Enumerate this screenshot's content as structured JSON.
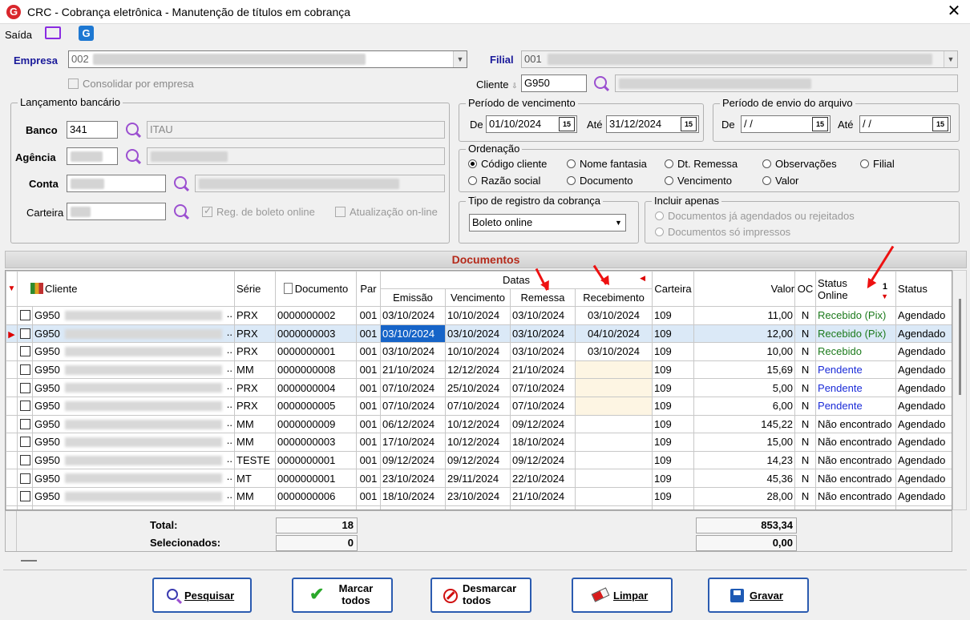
{
  "window": {
    "title": "CRC - Cobrança eletrônica - Manutenção de títulos em cobrança"
  },
  "menu": {
    "exit_label": "Saída"
  },
  "empresa": {
    "label": "Empresa",
    "code": "002",
    "consolidar_label": "Consolidar por empresa"
  },
  "filial": {
    "label": "Filial",
    "code": "001"
  },
  "cliente": {
    "label": "Cliente",
    "code": "G950"
  },
  "lancamento": {
    "title": "Lançamento bancário",
    "banco_label": "Banco",
    "banco_code": "341",
    "banco_name": "ITAU",
    "agencia_label": "Agência",
    "conta_label": "Conta",
    "carteira_label": "Carteira",
    "reg_boleto_label": "Reg. de boleto online",
    "atualizacao_label": "Atualização on-line"
  },
  "vencimento": {
    "title": "Período de vencimento",
    "de_label": "De",
    "de": "01/10/2024",
    "ate_label": "Até",
    "ate": "31/12/2024"
  },
  "envio": {
    "title": "Período de envio do arquivo",
    "de_label": "De",
    "de": " / /",
    "ate_label": "Até",
    "ate": " / /"
  },
  "ordenacao": {
    "title": "Ordenação",
    "options": [
      "Código cliente",
      "Nome fantasia",
      "Dt. Remessa",
      "Observações",
      "Filial",
      "Razão social",
      "Documento",
      "Vencimento",
      "Valor"
    ],
    "selected": "Código cliente"
  },
  "tipo_registro": {
    "title": "Tipo de registro da cobrança",
    "value": "Boleto online"
  },
  "incluir": {
    "title": "Incluir apenas",
    "opt1": "Documentos já agendados ou rejeitados",
    "opt2": "Documentos só impressos"
  },
  "section_title": "Documentos",
  "grid": {
    "headers": {
      "cliente": "Cliente",
      "serie": "Série",
      "documento": "Documento",
      "par": "Par",
      "datas": "Datas",
      "emissao": "Emissão",
      "vencimento": "Vencimento",
      "remessa": "Remessa",
      "recebimento": "Recebimento",
      "carteira": "Carteira",
      "valor": "Valor",
      "oc": "OC",
      "status_online": "Status Online",
      "sort_num": "1",
      "status": "Status"
    },
    "rows": [
      {
        "cliente": "G950",
        "serie": "PRX",
        "documento": "0000000002",
        "par": "001",
        "emissao": "03/10/2024",
        "vencimento": "10/10/2024",
        "remessa": "03/10/2024",
        "recebimento": "03/10/2024",
        "carteira": "109",
        "valor": "11,00",
        "oc": "N",
        "status_online": "Recebido (Pix)",
        "status": "Agendado"
      },
      {
        "cliente": "G950",
        "serie": "PRX",
        "documento": "0000000003",
        "par": "001",
        "emissao": "03/10/2024",
        "vencimento": "03/10/2024",
        "remessa": "03/10/2024",
        "recebimento": "04/10/2024",
        "carteira": "109",
        "valor": "12,00",
        "oc": "N",
        "status_online": "Recebido (Pix)",
        "status": "Agendado"
      },
      {
        "cliente": "G950",
        "serie": "PRX",
        "documento": "0000000001",
        "par": "001",
        "emissao": "03/10/2024",
        "vencimento": "10/10/2024",
        "remessa": "03/10/2024",
        "recebimento": "03/10/2024",
        "carteira": "109",
        "valor": "10,00",
        "oc": "N",
        "status_online": "Recebido",
        "status": "Agendado"
      },
      {
        "cliente": "G950",
        "serie": "MM",
        "documento": "0000000008",
        "par": "001",
        "emissao": "21/10/2024",
        "vencimento": "12/12/2024",
        "remessa": "21/10/2024",
        "recebimento": "",
        "carteira": "109",
        "valor": "15,69",
        "oc": "N",
        "status_online": "Pendente",
        "status": "Agendado"
      },
      {
        "cliente": "G950",
        "serie": "PRX",
        "documento": "0000000004",
        "par": "001",
        "emissao": "07/10/2024",
        "vencimento": "25/10/2024",
        "remessa": "07/10/2024",
        "recebimento": "",
        "carteira": "109",
        "valor": "5,00",
        "oc": "N",
        "status_online": "Pendente",
        "status": "Agendado"
      },
      {
        "cliente": "G950",
        "serie": "PRX",
        "documento": "0000000005",
        "par": "001",
        "emissao": "07/10/2024",
        "vencimento": "07/10/2024",
        "remessa": "07/10/2024",
        "recebimento": "",
        "carteira": "109",
        "valor": "6,00",
        "oc": "N",
        "status_online": "Pendente",
        "status": "Agendado"
      },
      {
        "cliente": "G950",
        "serie": "MM",
        "documento": "0000000009",
        "par": "001",
        "emissao": "06/12/2024",
        "vencimento": "10/12/2024",
        "remessa": "09/12/2024",
        "recebimento": "",
        "carteira": "109",
        "valor": "145,22",
        "oc": "N",
        "status_online": "Não encontrado",
        "status": "Agendado"
      },
      {
        "cliente": "G950",
        "serie": "MM",
        "documento": "0000000003",
        "par": "001",
        "emissao": "17/10/2024",
        "vencimento": "10/12/2024",
        "remessa": "18/10/2024",
        "recebimento": "",
        "carteira": "109",
        "valor": "15,00",
        "oc": "N",
        "status_online": "Não encontrado",
        "status": "Agendado"
      },
      {
        "cliente": "G950",
        "serie": "TESTE",
        "documento": "0000000001",
        "par": "001",
        "emissao": "09/12/2024",
        "vencimento": "09/12/2024",
        "remessa": "09/12/2024",
        "recebimento": "",
        "carteira": "109",
        "valor": "14,23",
        "oc": "N",
        "status_online": "Não encontrado",
        "status": "Agendado"
      },
      {
        "cliente": "G950",
        "serie": "MT",
        "documento": "0000000001",
        "par": "001",
        "emissao": "23/10/2024",
        "vencimento": "29/11/2024",
        "remessa": "22/10/2024",
        "recebimento": "",
        "carteira": "109",
        "valor": "45,36",
        "oc": "N",
        "status_online": "Não encontrado",
        "status": "Agendado"
      },
      {
        "cliente": "G950",
        "serie": "MM",
        "documento": "0000000006",
        "par": "001",
        "emissao": "18/10/2024",
        "vencimento": "23/10/2024",
        "remessa": "21/10/2024",
        "recebimento": "",
        "carteira": "109",
        "valor": "28,00",
        "oc": "N",
        "status_online": "Não encontrado",
        "status": "Agendado"
      }
    ]
  },
  "totals": {
    "total_label": "Total:",
    "total_count": "18",
    "total_value": "853,34",
    "sel_label": "Selecionados:",
    "sel_count": "0",
    "sel_value": "0,00"
  },
  "buttons": {
    "pesquisar": "Pesquisar",
    "marcar": "Marcar todos",
    "desmarcar": "Desmarcar todos",
    "limpar": "Limpar",
    "gravar": "Gravar"
  },
  "colors": {
    "accent": "#2b5bb0",
    "status_green": "#1c7a1c",
    "status_blue": "#1a2bd8",
    "section_title": "#b52a1a",
    "arrow": "#e11111"
  }
}
